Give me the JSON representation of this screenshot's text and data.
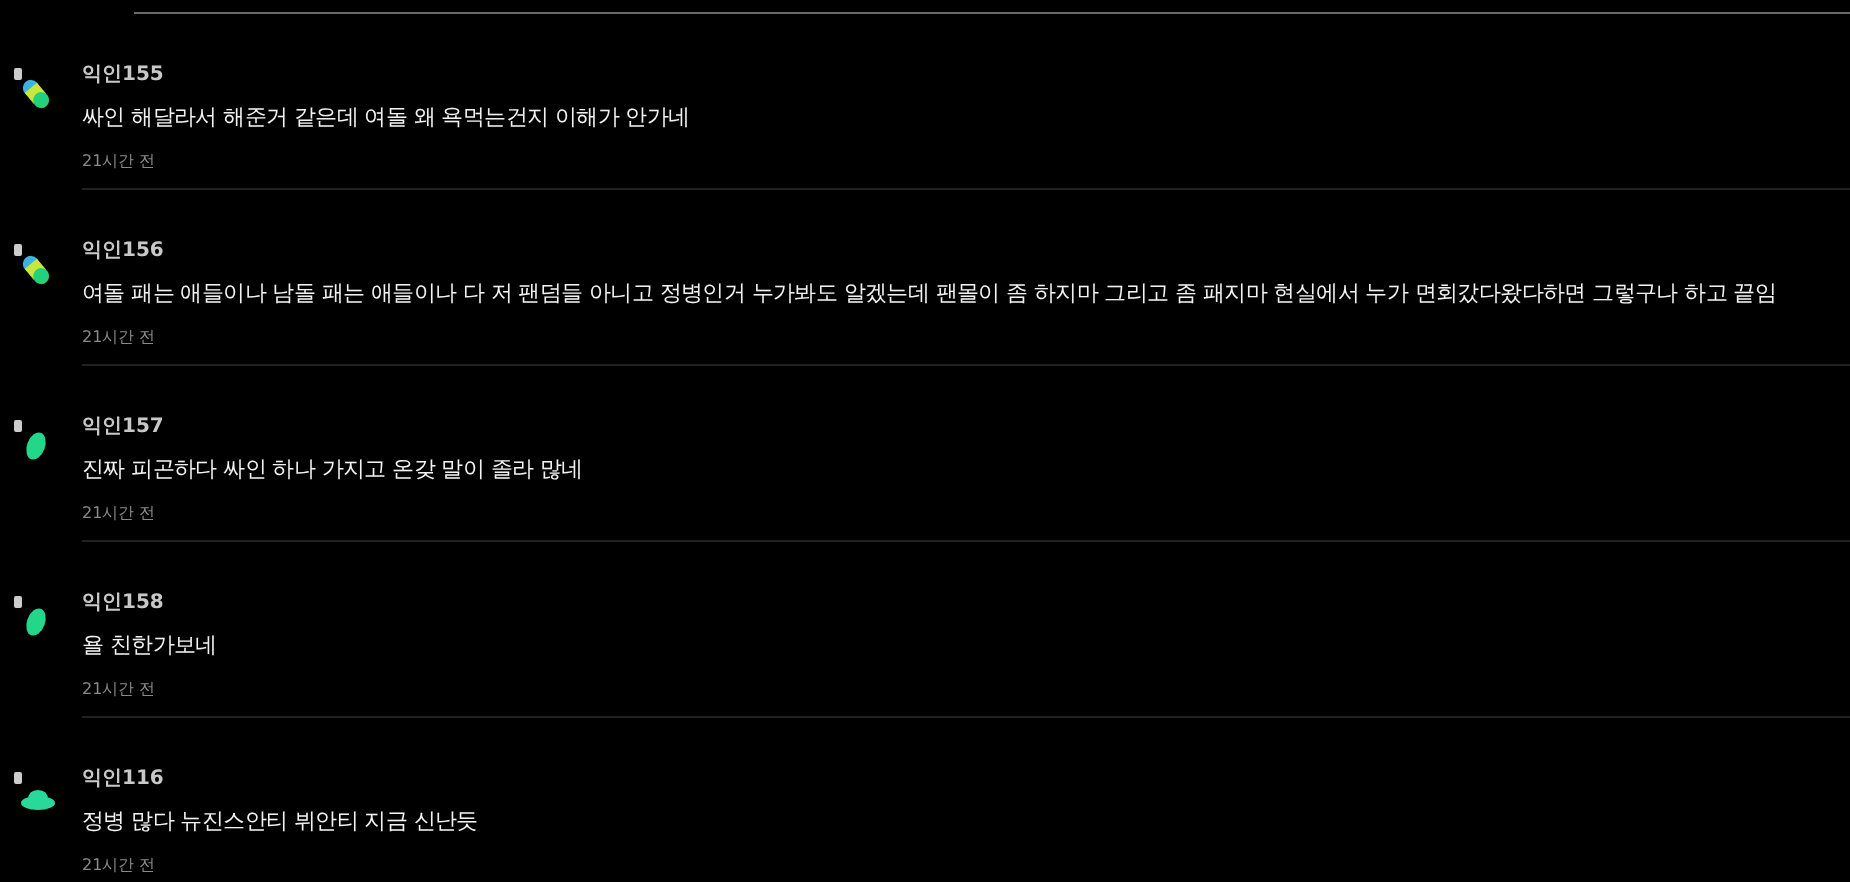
{
  "comments": [
    {
      "author": "익인155",
      "avatar": {
        "kind": "capsule"
      },
      "text": "싸인 해달라서 해준거 같은데 여돌 왜 욕먹는건지 이해가 안가네",
      "time": "21시간 전"
    },
    {
      "author": "익인156",
      "avatar": {
        "kind": "capsule"
      },
      "text": "여돌 패는 애들이나 남돌 패는 애들이나 다 저 팬덤들 아니고 정병인거 누가봐도 알겠는데 팬몰이 좀 하지마 그리고 좀 패지마 현실에서 누가 면회갔다왔다하면 그렇구나 하고 끝임",
      "time": "21시간 전"
    },
    {
      "author": "익인157",
      "avatar": {
        "kind": "pill"
      },
      "text": "진짜 피곤하다 싸인 하나 가지고 온갖 말이 졸라 많네",
      "time": "21시간 전"
    },
    {
      "author": "익인158",
      "avatar": {
        "kind": "pill"
      },
      "text": "욜 친한가보네",
      "time": "21시간 전"
    },
    {
      "author": "익인116",
      "avatar": {
        "kind": "hat"
      },
      "text": "정병 많다 뉴진스안티 뷔안티 지금 신난듯",
      "time": "21시간 전"
    }
  ]
}
